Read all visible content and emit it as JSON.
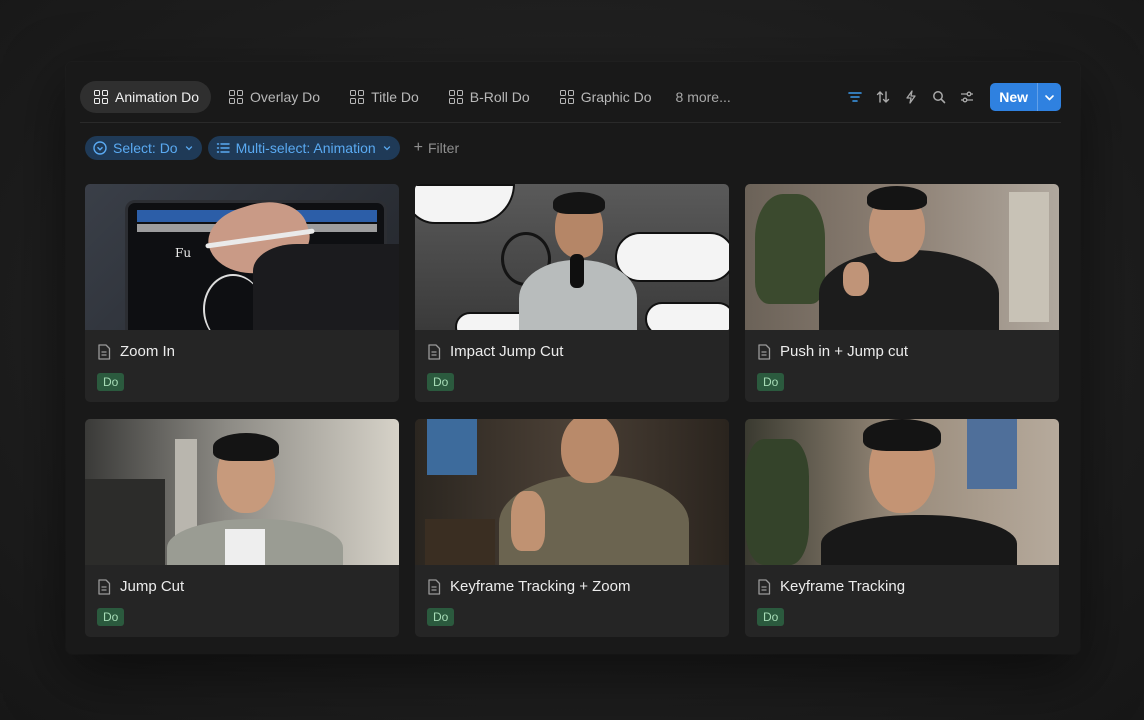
{
  "tabs": [
    {
      "label": "Animation Do",
      "active": true
    },
    {
      "label": "Overlay Do",
      "active": false
    },
    {
      "label": "Title Do",
      "active": false
    },
    {
      "label": "B-Roll Do",
      "active": false
    },
    {
      "label": "Graphic Do",
      "active": false
    }
  ],
  "more_tabs": "8 more...",
  "toolbar": {
    "icons": [
      "filter-icon",
      "sort-icon",
      "lightning-icon",
      "search-icon",
      "settings-sliders-icon"
    ],
    "new_label": "New"
  },
  "filters": {
    "select_chip": "Select: Do",
    "multiselect_chip": "Multi-select: Animation",
    "add_filter": "Filter"
  },
  "cards": [
    {
      "title": "Zoom In",
      "tag": "Do"
    },
    {
      "title": "Impact Jump Cut",
      "tag": "Do"
    },
    {
      "title": "Push in + Jump cut",
      "tag": "Do"
    },
    {
      "title": "Jump Cut",
      "tag": "Do"
    },
    {
      "title": "Keyframe Tracking + Zoom",
      "tag": "Do"
    },
    {
      "title": "Keyframe Tracking",
      "tag": "Do"
    }
  ],
  "colors": {
    "accent": "#2f81e0",
    "chip_bg": "#1f3a57",
    "chip_text": "#5aaaf2",
    "tag_bg": "#2b5a3e",
    "tag_text": "#a6dcb6"
  }
}
